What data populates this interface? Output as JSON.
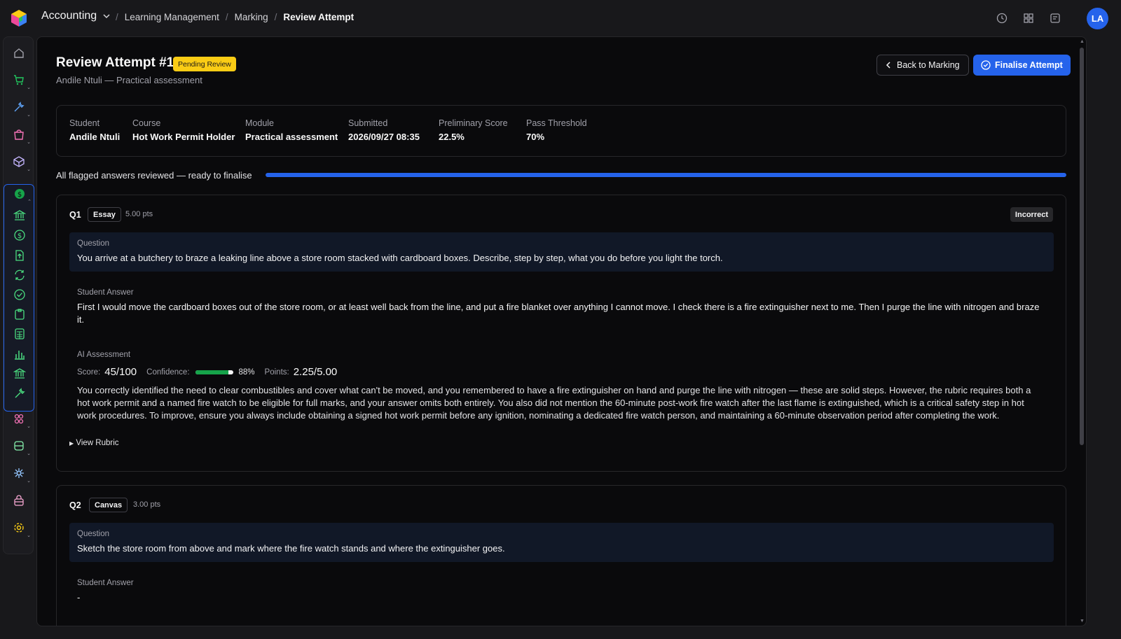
{
  "topbar": {
    "app_name": "Accounting",
    "breadcrumb": [
      "Learning Management",
      "Marking",
      "Review Attempt"
    ],
    "avatar_initials": "LA",
    "icons": [
      "clock-icon",
      "grid-icon",
      "notes-icon"
    ]
  },
  "sidebar": {
    "items": [
      "home-icon",
      "cart-icon",
      "tools-icon",
      "bag-icon",
      "box-icon",
      "dollar-icon",
      "bank-icon",
      "dollar-icon",
      "export-icon",
      "refresh-icon",
      "check-icon",
      "clipboard-icon",
      "calculator-icon",
      "bar-chart-icon",
      "bank-icon",
      "wrench-icon",
      "people-icon",
      "database-icon",
      "network-icon",
      "lock-box-icon",
      "settings-icon"
    ]
  },
  "header": {
    "title": "Review Attempt #1",
    "status_badge": "Pending Review",
    "subtitle": "Andile Ntuli — Practical assessment",
    "back_label": "Back to Marking",
    "finalise_label": "Finalise Attempt"
  },
  "info": [
    {
      "label": "Student",
      "value": "Andile Ntuli"
    },
    {
      "label": "Course",
      "value": "Hot Work Permit Holder"
    },
    {
      "label": "Module",
      "value": "Practical assessment"
    },
    {
      "label": "Submitted",
      "value": "2026/09/27 08:35"
    },
    {
      "label": "Preliminary Score",
      "value": "22.5%"
    },
    {
      "label": "Pass Threshold",
      "value": "70%"
    }
  ],
  "progress": {
    "text": "All flagged answers reviewed — ready to finalise",
    "percent": 100
  },
  "questions": [
    {
      "num": "Q1",
      "type": "Essay",
      "points": "5.00 pts",
      "status": "Incorrect",
      "question_label": "Question",
      "question": "You arrive at a butchery to braze a leaking line above a store room stacked with cardboard boxes. Describe, step by step, what you do before you light the torch.",
      "answer_label": "Student Answer",
      "answer": "First I would move the cardboard boxes out of the store room, or at least well back from the line, and put a fire blanket over anything I cannot move. I check there is a fire extinguisher next to me. Then I purge the line with nitrogen and braze it.",
      "ai_label": "AI Assessment",
      "score_label": "Score:",
      "score": "45/100",
      "confidence_label": "Confidence:",
      "confidence": "88%",
      "confidence_value": 88,
      "points_label": "Points:",
      "points_awarded": "2.25/5.00",
      "feedback": "You correctly identified the need to clear combustibles and cover what can't be moved, and you remembered to have a fire extinguisher on hand and purge the line with nitrogen — these are solid steps. However, the rubric requires both a hot work permit and a named fire watch to be eligible for full marks, and your answer omits both entirely. You also did not mention the 60-minute post-work fire watch after the last flame is extinguished, which is a critical safety step in hot work procedures. To improve, ensure you always include obtaining a signed hot work permit before any ignition, nominating a dedicated fire watch person, and maintaining a 60-minute observation period after completing the work.",
      "rubric_label": "View Rubric"
    },
    {
      "num": "Q2",
      "type": "Canvas",
      "points": "3.00 pts",
      "question_label": "Question",
      "question": "Sketch the store room from above and mark where the fire watch stands and where the extinguisher goes.",
      "answer_label": "Student Answer",
      "answer": "-"
    }
  ],
  "colors": {
    "accent": "#2563eb",
    "pending": "#facc15",
    "confidence": "#16a34a",
    "background": "#0a0a0c"
  }
}
